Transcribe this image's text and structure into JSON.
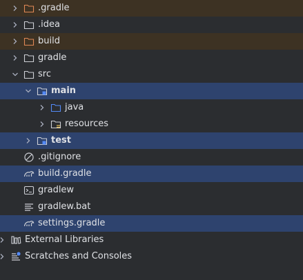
{
  "tree": {
    "rows": [
      {
        "label": ".gradle",
        "icon": "folder-icon",
        "state": "excluded"
      },
      {
        "label": ".idea",
        "icon": "folder-icon",
        "state": "normal"
      },
      {
        "label": "build",
        "icon": "folder-icon",
        "state": "excluded"
      },
      {
        "label": "gradle",
        "icon": "folder-icon",
        "state": "normal"
      },
      {
        "label": "src",
        "icon": "folder-icon",
        "state": "expanded"
      },
      {
        "label": "main",
        "icon": "module-folder-icon",
        "state": "selected-expanded"
      },
      {
        "label": "java",
        "icon": "source-folder-icon",
        "state": "normal"
      },
      {
        "label": "resources",
        "icon": "resources-folder-icon",
        "state": "normal"
      },
      {
        "label": "test",
        "icon": "module-folder-icon",
        "state": "selected"
      },
      {
        "label": ".gitignore",
        "icon": "ignore-file-icon",
        "state": "normal"
      },
      {
        "label": "build.gradle",
        "icon": "gradle-file-icon",
        "state": "selected"
      },
      {
        "label": "gradlew",
        "icon": "terminal-file-icon",
        "state": "normal"
      },
      {
        "label": "gradlew.bat",
        "icon": "text-file-icon",
        "state": "normal"
      },
      {
        "label": "settings.gradle",
        "icon": "gradle-file-icon",
        "state": "selected"
      },
      {
        "label": "External Libraries",
        "icon": "libraries-icon",
        "state": "normal"
      },
      {
        "label": "Scratches and Consoles",
        "icon": "scratches-icon",
        "state": "normal"
      }
    ]
  },
  "colors": {
    "background": "#2b2d30",
    "selection": "#2e436e",
    "excluded": "#3d3223",
    "text": "#dfe1e5",
    "excluded_folder": "#e08855",
    "folder": "#ced0d6",
    "source_folder": "#548af7"
  }
}
